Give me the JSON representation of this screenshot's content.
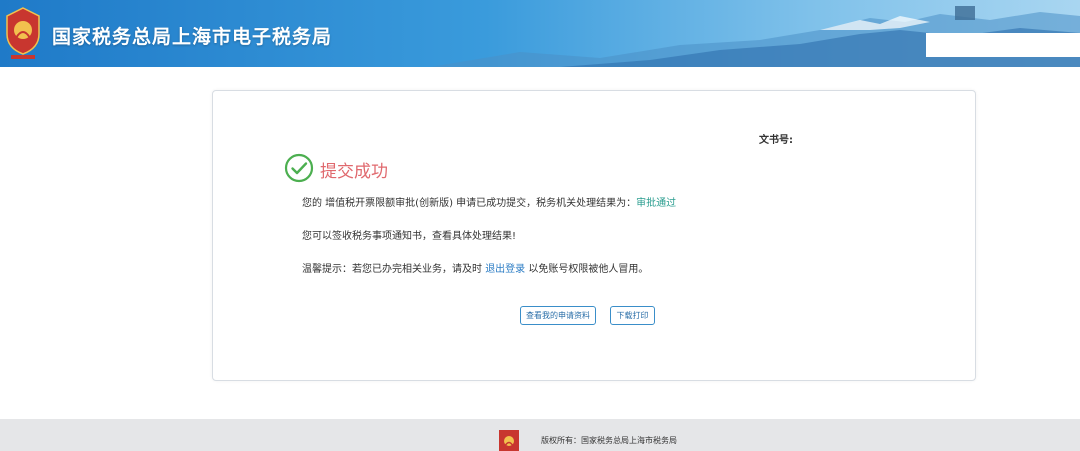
{
  "header": {
    "title": "国家税务总局上海市电子税务局",
    "emblem_icon": "tax-emblem-icon"
  },
  "card": {
    "doc_no_label": "文书号:",
    "success_title": "提交成功",
    "message_prefix": "您的 增值税开票限额审批(创新版) 申请已成功提交，税务机关处理结果为：",
    "result_link": "审批通过",
    "message_notice": "您可以签收税务事项通知书，查看具体处理结果!",
    "tip_prefix": "温馨提示：若您已办完相关业务，请及时 ",
    "logout_link": "退出登录",
    "tip_suffix": " 以免账号权限被他人冒用。",
    "view_button": "查看我的申请资料",
    "print_button": "下载打印"
  },
  "footer": {
    "copyright": "版权所有：国家税务总局上海市税务局"
  },
  "colors": {
    "success_green": "#4caf50",
    "title_red": "#e0696e",
    "link_teal": "#2a9d8f",
    "banner_blue": "#1f7ac8"
  }
}
